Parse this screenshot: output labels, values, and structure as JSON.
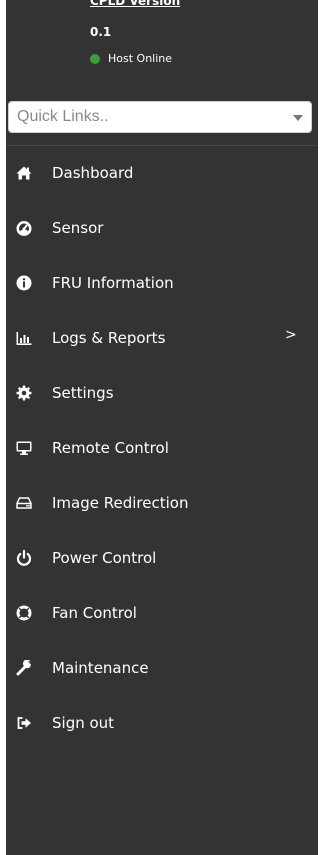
{
  "info": {
    "cpld_title": "CPLD Version",
    "cpld_value": "0.1",
    "host_status": "Host Online",
    "status_color": "#3c9d3c"
  },
  "quick_links": {
    "placeholder": "Quick Links.."
  },
  "nav": {
    "items": [
      {
        "label": "Dashboard",
        "icon": "home-icon"
      },
      {
        "label": "Sensor",
        "icon": "gauge-icon"
      },
      {
        "label": "FRU Information",
        "icon": "info-icon"
      },
      {
        "label": "Logs & Reports",
        "icon": "bar-chart-icon",
        "has_submenu": true
      },
      {
        "label": "Settings",
        "icon": "gear-icon"
      },
      {
        "label": "Remote Control",
        "icon": "monitor-icon"
      },
      {
        "label": "Image Redirection",
        "icon": "drive-icon"
      },
      {
        "label": "Power Control",
        "icon": "power-icon"
      },
      {
        "label": "Fan Control",
        "icon": "lifebuoy-icon"
      },
      {
        "label": "Maintenance",
        "icon": "wrench-icon"
      },
      {
        "label": "Sign out",
        "icon": "sign-out-icon"
      }
    ],
    "submenu_chevron": ">"
  },
  "colors": {
    "sidebar_bg": "#333333",
    "text": "#ffffff"
  }
}
